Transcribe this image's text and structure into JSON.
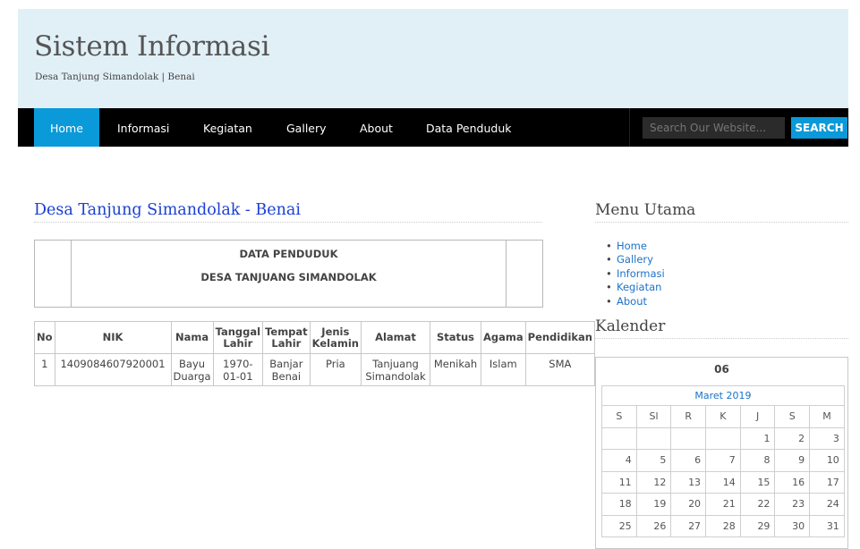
{
  "header": {
    "title": "Sistem Informasi",
    "subtitle": "Desa Tanjung Simandolak | Benai"
  },
  "nav": {
    "items": [
      "Home",
      "Informasi",
      "Kegiatan",
      "Gallery",
      "About",
      "Data Penduduk"
    ],
    "active": "Home"
  },
  "search": {
    "placeholder": "Search Our Website...",
    "button": "SEARCH"
  },
  "main": {
    "title": "Desa Tanjung Simandolak - Benai",
    "box_line1": "DATA PENDUDUK",
    "box_line2": "DESA TANJUANG SIMANDOLAK",
    "table": {
      "headers": [
        "No",
        "NIK",
        "Nama",
        "Tanggal Lahir",
        "Tempat Lahir",
        "Jenis Kelamin",
        "Alamat",
        "Status",
        "Agama",
        "Pendidikan"
      ],
      "rows": [
        [
          "1",
          "1409084607920001",
          "Bayu Duarga",
          "1970-01-01",
          "Banjar Benai",
          "Pria",
          "Tanjuang Simandolak",
          "Menikah",
          "Islam",
          "SMA"
        ]
      ]
    }
  },
  "sidebar": {
    "menu_title": "Menu Utama",
    "menu": [
      "Home",
      "Gallery",
      "Informasi",
      "Kegiatan",
      "About"
    ],
    "calendar_title": "Kalender",
    "calendar": {
      "day": "06",
      "month": "Maret 2019",
      "weekdays": [
        "S",
        "Sl",
        "R",
        "K",
        "J",
        "S",
        "M"
      ],
      "weeks": [
        [
          "",
          "",
          "",
          "",
          "1",
          "2",
          "3"
        ],
        [
          "4",
          "5",
          "6",
          "7",
          "8",
          "9",
          "10"
        ],
        [
          "11",
          "12",
          "13",
          "14",
          "15",
          "16",
          "17"
        ],
        [
          "18",
          "19",
          "20",
          "21",
          "22",
          "23",
          "24"
        ],
        [
          "25",
          "26",
          "27",
          "28",
          "29",
          "30",
          "31"
        ]
      ]
    }
  }
}
